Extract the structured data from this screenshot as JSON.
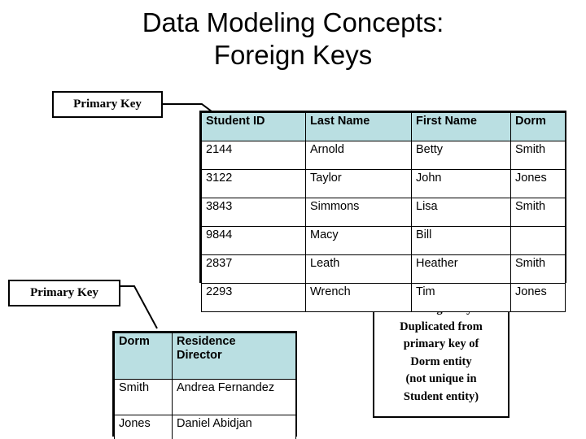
{
  "slide": {
    "title_lines": [
      "Data Modeling Concepts:",
      "Foreign Keys"
    ],
    "header_fill": "#badfe2",
    "border_color": "#000000",
    "background": "#ffffff"
  },
  "callouts": {
    "primary_key_top": "Primary Key",
    "primary_key_bottom": "Primary Key",
    "foreign_key_lines": [
      "Foreign Key",
      "Duplicated from",
      "primary key of",
      "Dorm entity",
      "(not unique in",
      "Student entity)"
    ]
  },
  "student_table": {
    "columns": [
      "Student ID",
      "Last Name",
      "First Name",
      "Dorm"
    ],
    "rows": [
      [
        "2144",
        "Arnold",
        "Betty",
        "Smith"
      ],
      [
        "3122",
        "Taylor",
        "John",
        "Jones"
      ],
      [
        "3843",
        "Simmons",
        "Lisa",
        "Smith"
      ],
      [
        "9844",
        "Macy",
        "Bill",
        ""
      ],
      [
        "2837",
        "Leath",
        "Heather",
        "Smith"
      ],
      [
        "2293",
        "Wrench",
        "Tim",
        "Jones"
      ]
    ]
  },
  "dorm_table": {
    "columns": [
      "Dorm",
      "Residence Director"
    ],
    "column_header_lines": [
      [
        "Dorm"
      ],
      [
        "Residence",
        "Director"
      ]
    ],
    "rows": [
      [
        "Smith",
        "Andrea Fernandez"
      ],
      [
        "Jones",
        "Daniel Abidjan"
      ]
    ]
  }
}
